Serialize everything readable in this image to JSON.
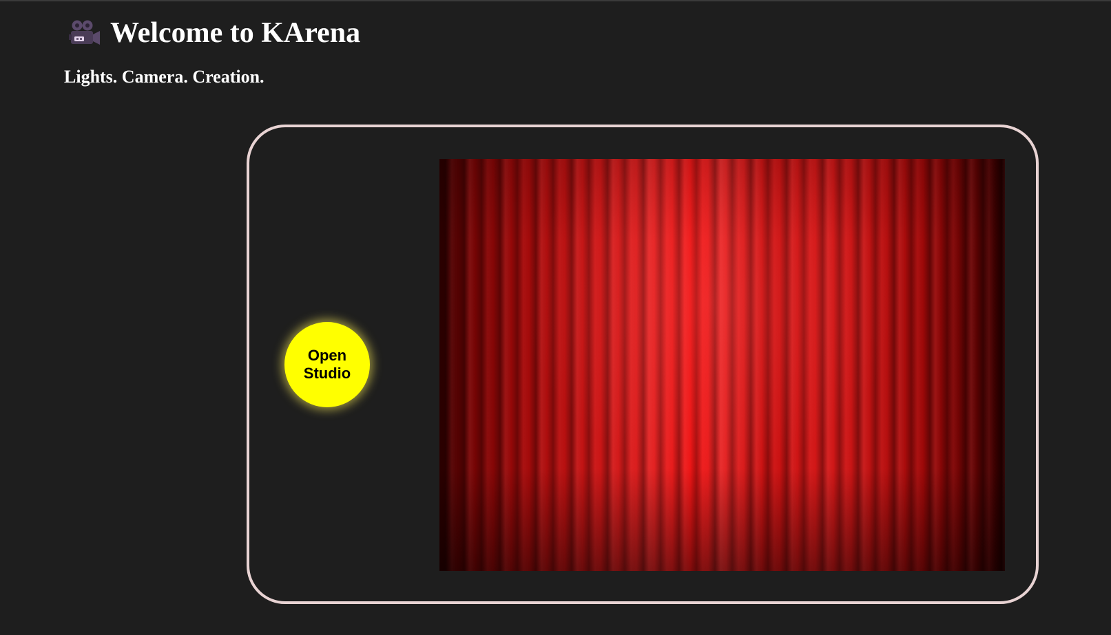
{
  "header": {
    "icon": "movie-camera-icon",
    "title": "Welcome to KArena",
    "tagline": "Lights. Camera. Creation."
  },
  "stage": {
    "open_button_label": "Open Studio",
    "curtain_image": "red-theater-curtain"
  },
  "colors": {
    "background": "#1e1e1e",
    "text": "#ffffff",
    "frame_border": "#e8d3d3",
    "button_fill": "#ffff00",
    "button_text": "#000000",
    "curtain": "#c81010"
  }
}
